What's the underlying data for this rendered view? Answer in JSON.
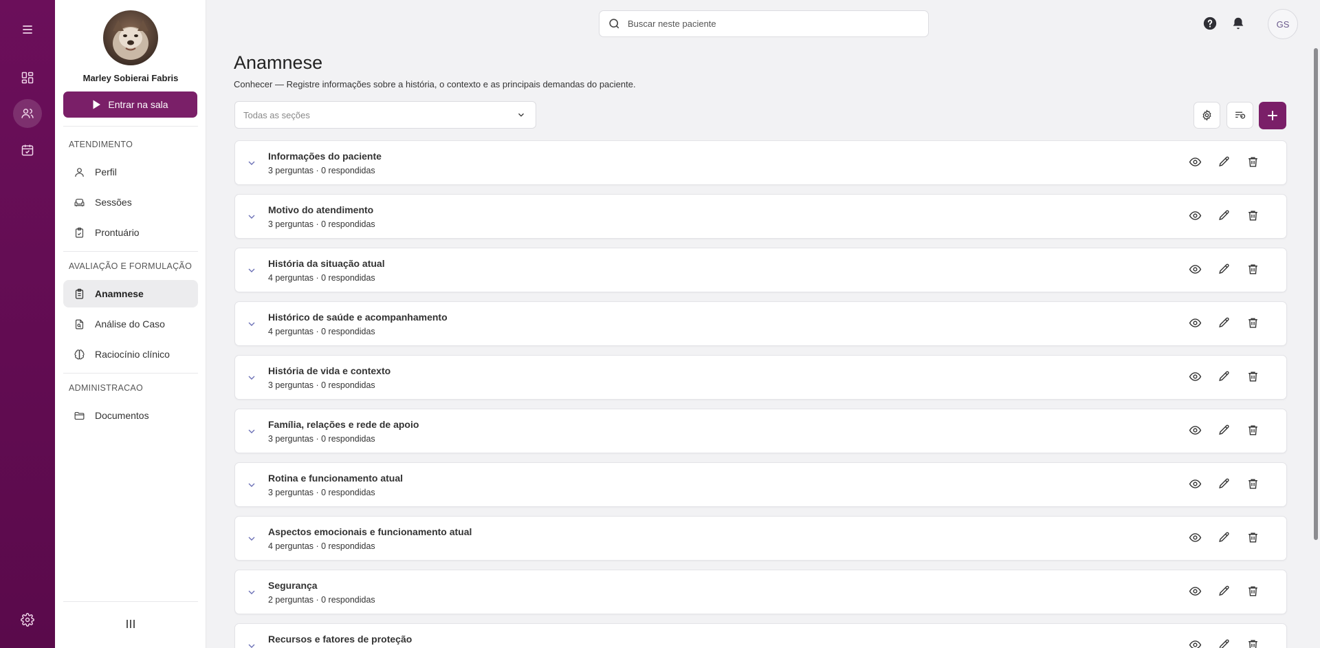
{
  "rail": {
    "items": [
      "menu-icon",
      "dashboard-icon",
      "patients-icon",
      "calendar-icon"
    ],
    "bottom": "gear-icon"
  },
  "sidebar": {
    "user_name": "Marley Sobierai Fabris",
    "enter_label": "Entrar na sala",
    "sections": [
      {
        "title": "ATENDIMENTO",
        "items": [
          {
            "label": "Perfil",
            "icon": "user-icon"
          },
          {
            "label": "Sessões",
            "icon": "couch-icon"
          },
          {
            "label": "Prontuário",
            "icon": "clipboard-icon"
          }
        ]
      },
      {
        "title": "AVALIAÇÃO E FORMULAÇÃO",
        "items": [
          {
            "label": "Anamnese",
            "icon": "clipboard-list-icon",
            "active": true
          },
          {
            "label": "Análise do Caso",
            "icon": "file-search-icon"
          },
          {
            "label": "Raciocínio clínico",
            "icon": "brain-icon"
          }
        ]
      },
      {
        "title": "ADMINISTRACAO",
        "items": [
          {
            "label": "Documentos",
            "icon": "folder-icon"
          }
        ]
      }
    ]
  },
  "topbar": {
    "search_placeholder": "Buscar neste paciente",
    "user_initials": "GS"
  },
  "page": {
    "title": "Anamnese",
    "subtitle": "Conhecer — Registre informações sobre a história, o contexto e as principais demandas do paciente.",
    "filter_placeholder": "Todas as seções"
  },
  "sections": [
    {
      "title": "Informações do paciente",
      "meta": "3 perguntas · 0 respondidas"
    },
    {
      "title": "Motivo do atendimento",
      "meta": "3 perguntas · 0 respondidas"
    },
    {
      "title": "História da situação atual",
      "meta": "4 perguntas · 0 respondidas"
    },
    {
      "title": "Histórico de saúde e acompanhamento",
      "meta": "4 perguntas · 0 respondidas"
    },
    {
      "title": "História de vida e contexto",
      "meta": "3 perguntas · 0 respondidas"
    },
    {
      "title": "Família, relações e rede de apoio",
      "meta": "3 perguntas · 0 respondidas"
    },
    {
      "title": "Rotina e funcionamento atual",
      "meta": "3 perguntas · 0 respondidas"
    },
    {
      "title": "Aspectos emocionais e funcionamento atual",
      "meta": "4 perguntas · 0 respondidas"
    },
    {
      "title": "Segurança",
      "meta": "2 perguntas · 0 respondidas"
    },
    {
      "title": "Recursos e fatores de proteção",
      "meta": ""
    }
  ],
  "colors": {
    "brand": "#7a1f68",
    "rail": "#5f0c50",
    "chevron": "#6a6fb5"
  }
}
